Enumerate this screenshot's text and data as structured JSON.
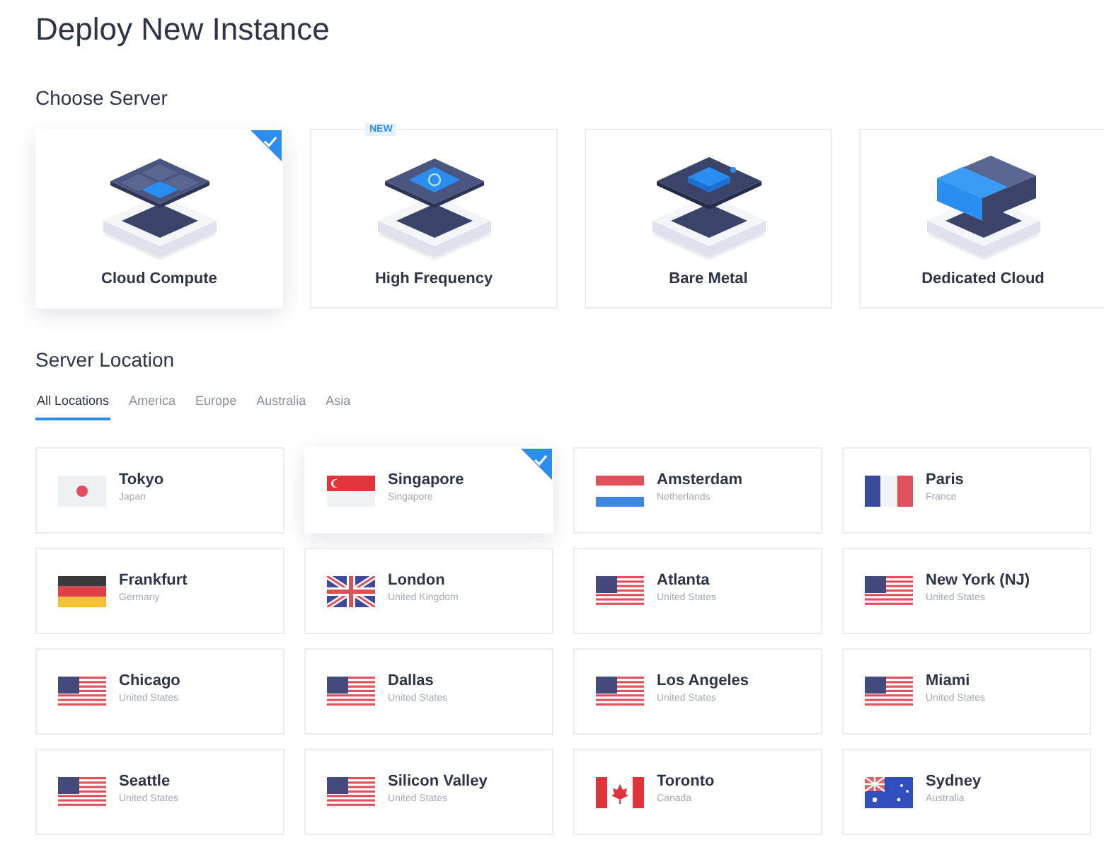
{
  "page_title": "Deploy New Instance",
  "server_section": {
    "heading": "Choose Server",
    "options": [
      {
        "label": "Cloud Compute",
        "kind": "compute",
        "selected": true
      },
      {
        "label": "High Frequency",
        "kind": "frequency",
        "selected": false,
        "badge": "NEW"
      },
      {
        "label": "Bare Metal",
        "kind": "metal",
        "selected": false
      },
      {
        "label": "Dedicated Cloud",
        "kind": "dedicated",
        "selected": false
      }
    ]
  },
  "location_section": {
    "heading": "Server Location",
    "tabs": [
      {
        "label": "All Locations",
        "selected": true
      },
      {
        "label": "America",
        "selected": false
      },
      {
        "label": "Europe",
        "selected": false
      },
      {
        "label": "Australia",
        "selected": false
      },
      {
        "label": "Asia",
        "selected": false
      }
    ],
    "locations": [
      {
        "city": "Tokyo",
        "country": "Japan",
        "kind": "jp",
        "selected": false
      },
      {
        "city": "Singapore",
        "country": "Singapore",
        "kind": "sg",
        "selected": true
      },
      {
        "city": "Amsterdam",
        "country": "Netherlands",
        "kind": "nl",
        "selected": false
      },
      {
        "city": "Paris",
        "country": "France",
        "kind": "fr",
        "selected": false
      },
      {
        "city": "Frankfurt",
        "country": "Germany",
        "kind": "de",
        "selected": false
      },
      {
        "city": "London",
        "country": "United Kingdom",
        "kind": "gb",
        "selected": false
      },
      {
        "city": "Atlanta",
        "country": "United States",
        "kind": "us",
        "selected": false
      },
      {
        "city": "New York (NJ)",
        "country": "United States",
        "kind": "us",
        "selected": false
      },
      {
        "city": "Chicago",
        "country": "United States",
        "kind": "us",
        "selected": false
      },
      {
        "city": "Dallas",
        "country": "United States",
        "kind": "us",
        "selected": false
      },
      {
        "city": "Los Angeles",
        "country": "United States",
        "kind": "us",
        "selected": false
      },
      {
        "city": "Miami",
        "country": "United States",
        "kind": "us",
        "selected": false
      },
      {
        "city": "Seattle",
        "country": "United States",
        "kind": "us",
        "selected": false
      },
      {
        "city": "Silicon Valley",
        "country": "United States",
        "kind": "us",
        "selected": false
      },
      {
        "city": "Toronto",
        "country": "Canada",
        "kind": "ca",
        "selected": false
      },
      {
        "city": "Sydney",
        "country": "Australia",
        "kind": "au",
        "selected": false
      }
    ]
  }
}
